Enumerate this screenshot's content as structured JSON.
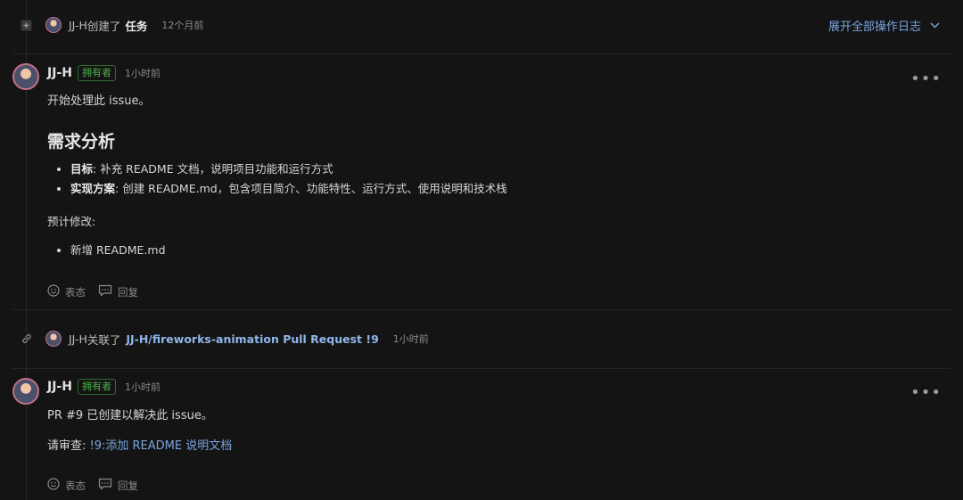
{
  "create_event": {
    "actor": "JJ-H",
    "verb": "创建了",
    "object": "任务",
    "time": "12个月前",
    "expand_label": "展开全部操作日志"
  },
  "comment1": {
    "author": "JJ-H",
    "badge": "拥有者",
    "time": "1小时前",
    "intro": "开始处理此 issue。",
    "heading": "需求分析",
    "bullets": [
      {
        "label": "目标",
        "text": ": 补充 README 文档，说明项目功能和运行方式"
      },
      {
        "label": "实现方案",
        "text": ": 创建 README.md，包含项目简介、功能特性、运行方式、使用说明和技术栈"
      }
    ],
    "plan_label": "预计修改:",
    "changes": [
      "新增 README.md"
    ],
    "react_label": "表态",
    "reply_label": "回复"
  },
  "link_event": {
    "actor": "JJ-H",
    "verb": "关联了",
    "target": "JJ-H/fireworks-animation Pull Request !9",
    "time": "1小时前"
  },
  "comment2": {
    "author": "JJ-H",
    "badge": "拥有者",
    "time": "1小时前",
    "text": "PR #9 已创建以解决此 issue。",
    "review_label": "请审查: ",
    "review_link": "!9:添加 README 说明文档",
    "react_label": "表态",
    "reply_label": "回复"
  }
}
